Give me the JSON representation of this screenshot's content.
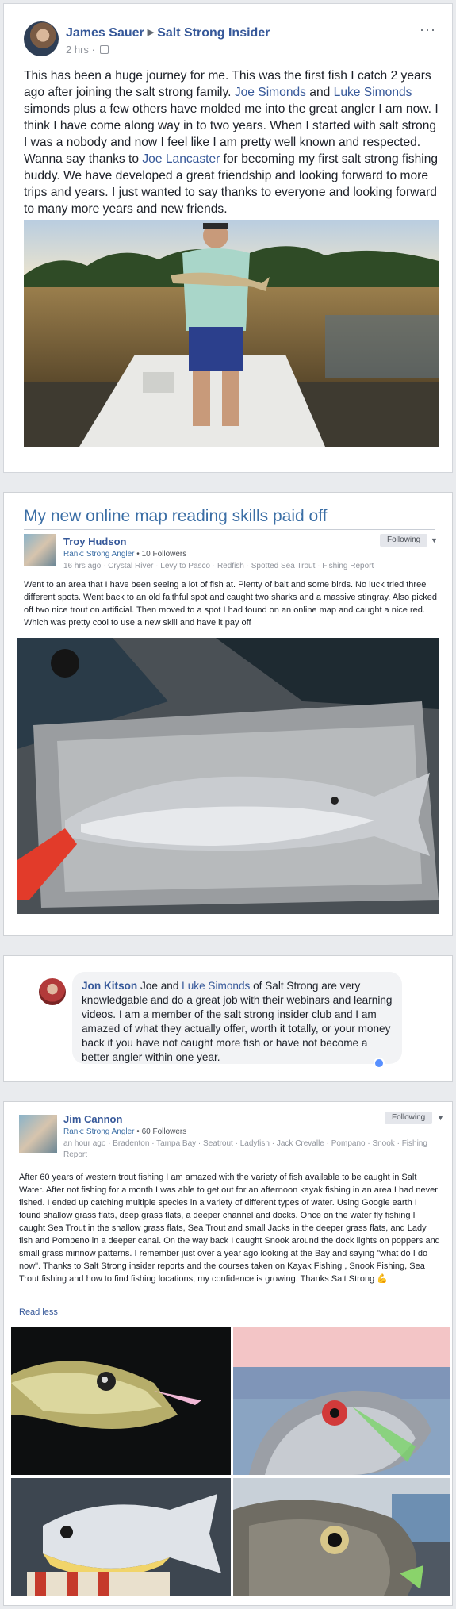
{
  "post1": {
    "author": "James Sauer",
    "group": "Salt Strong Insider",
    "time": "2 hrs",
    "more_label": "···",
    "text_parts": [
      "This has been a huge journey for me. This was the first fish I catch 2 years ago after joining the salt strong family. ",
      "Joe Simonds",
      " and ",
      "Luke Simonds",
      " simonds plus a few others have molded me into the great angler I am now. I think I have come along way in to two years. When I started with salt strong I was a nobody and now I feel like I am pretty well known and respected. Wanna say thanks to ",
      "Joe Lancaster",
      " for becoming my first salt strong fishing buddy. We have developed a great friendship and looking forward to more trips and years. I just wanted to say thanks to everyone and looking forward to many more years and new friends."
    ]
  },
  "post2": {
    "title": "My new online map reading skills paid off",
    "author": "Troy Hudson",
    "rank_label": "Rank: Strong Angler",
    "followers": "10 Followers",
    "tags": "16 hrs ago · Crystal River · Levy to Pasco · Redfish · Spotted Sea Trout · Fishing Report",
    "follow_label": "Following",
    "text": "Went to an area that I have been seeing a lot of fish at. Plenty of bait and some birds. No luck tried three different spots. Went back to an old faithful spot and caught two sharks and a massive stingray. Also picked off two nice trout on artificial. Then moved to a spot I had found on an online map and caught a nice red. Which was pretty cool to use a new skill and have it pay off"
  },
  "comment": {
    "author": "Jon Kitson",
    "text_parts": [
      " Joe and ",
      "Luke Simonds",
      " of Salt Strong are very knowledgable and do a great job with their webinars and learning videos. I am a member of the salt strong insider club and I am amazed of what they actually offer, worth it totally, or your money back if you have not caught more fish or have not become a better angler within one year."
    ]
  },
  "post3": {
    "author": "Jim Cannon",
    "rank_label": "Rank: Strong Angler",
    "followers": "60 Followers",
    "tags": "an hour ago · Bradenton · Tampa Bay · Seatrout · Ladyfish · Jack Crevalle · Pompano · Snook · Fishing Report",
    "follow_label": "Following",
    "text": "After 60 years of western trout fishing I am amazed with the variety of fish available to be caught in Salt Water. After not fishing for a month I was able to get out for an afternoon kayak fishing in an area I had never fished. I ended up catching multiple species in a variety of different types of water. Using Google earth I found shallow grass flats, deep grass flats, a deeper channel and docks. Once on the water fly fishing I caught Sea Trout in the shallow grass flats, Sea Trout and small Jacks in the deeper grass flats, and Lady fish and Pompeno in a deeper canal. On the way back I caught Snook around the dock lights on poppers and small grass minnow patterns. I remember just over a year ago looking at the Bay and saying \"what do I do now\". Thanks to Salt Strong insider reports and the courses taken on Kayak Fishing , Snook Fishing, Sea Trout fishing and how to find fishing locations, my confidence is growing. Thanks Salt Strong 💪",
    "read_less": "Read less"
  }
}
